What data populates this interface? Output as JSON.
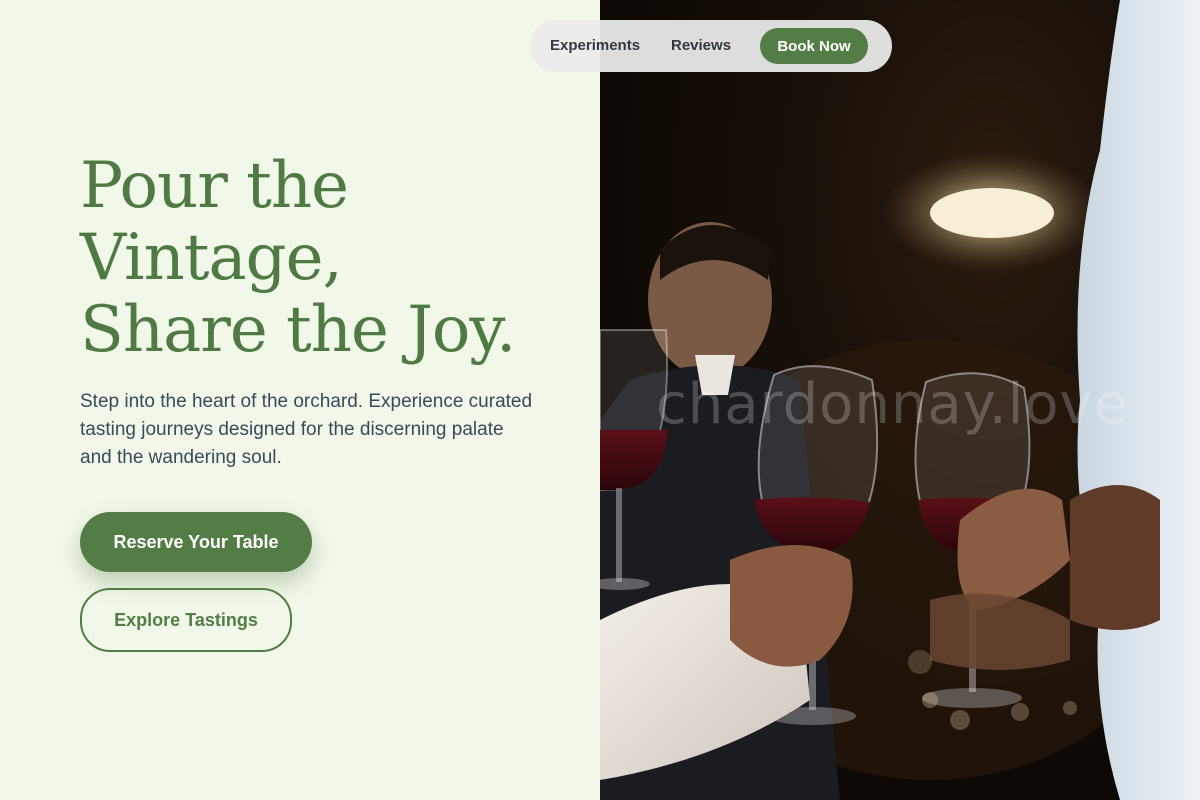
{
  "nav": {
    "links": [
      "Experiments",
      "Reviews"
    ],
    "book_label": "Book Now"
  },
  "hero": {
    "title_lines": [
      "Pour the",
      "Vintage,",
      "Share the Joy."
    ],
    "description": "Step into the heart of the orchard. Experience curated tasting journeys designed for the discerning palate and the wandering soul.",
    "primary_cta": "Reserve Your Table",
    "secondary_cta": "Explore Tastings"
  },
  "photo": {
    "watermark": "chardonnay.love",
    "alt": "Guests raising glasses of red wine"
  },
  "colors": {
    "accent": "#537d44",
    "title": "#4f7a43",
    "background": "#f1f8e9",
    "body_text": "#3a4a59"
  }
}
